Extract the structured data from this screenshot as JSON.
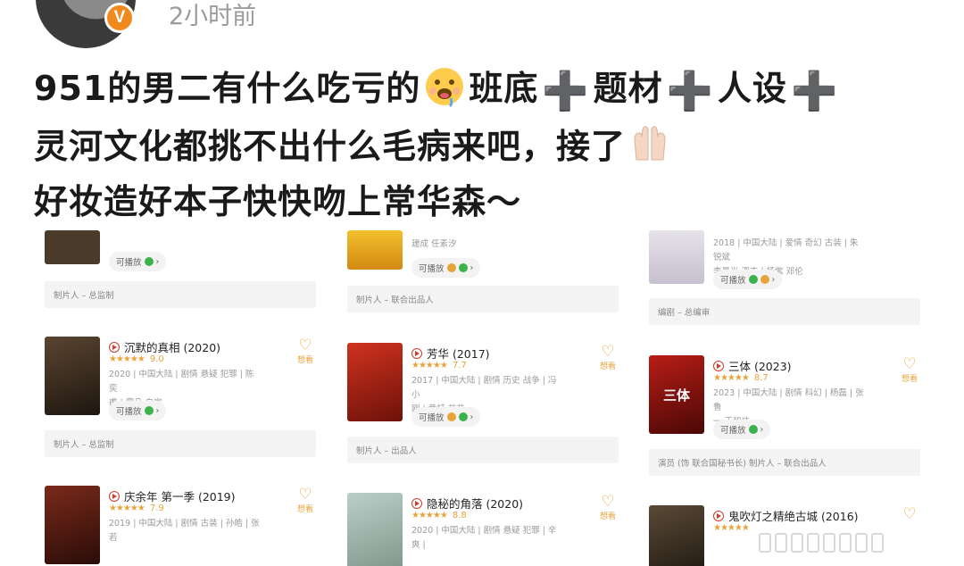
{
  "header": {
    "verified_badge": "V",
    "time_ago": "2小时前"
  },
  "post": {
    "line1": {
      "a": "951的男二有什么吃亏的",
      "b": "班底",
      "c": "题材",
      "d": "人设"
    },
    "line2": {
      "a": "灵河文化都挑不出什么毛病来吧，接了"
    },
    "line3": {
      "a": "好妆造好本子快快吻上常华森～"
    },
    "plus_symbol": "➕"
  },
  "common": {
    "playable": "可播放",
    "want": "想看",
    "heart": "♡",
    "chevron": "›",
    "stars": "★★★★★"
  },
  "columns": [
    {
      "top_fragment": {
        "role": "制片人 – 总监制"
      },
      "movies": [
        {
          "title": "沉默的真相 (2020)",
          "score": "9.0",
          "meta1": "2020 | 中国大陆 | 剧情 悬疑 犯罪 | 陈奕",
          "meta2": "甫 | 廖凡 白宇",
          "role": "制片人 – 总监制",
          "poster_color": "#3b2a1e"
        },
        {
          "title": "庆余年 第一季 (2019)",
          "score": "7.9",
          "meta1": "2019 | 中国大陆 | 剧情 古装 | 孙皓 | 张若",
          "meta2": "",
          "role": "",
          "poster_color": "#6a1c16"
        }
      ]
    },
    {
      "top_fragment": {
        "meta": "建成 任素汐",
        "role": "制片人 – 联合出品人"
      },
      "movies": [
        {
          "title": "芳华 (2017)",
          "score": "7.7",
          "meta1": "2017 | 中国大陆 | 剧情 历史 战争 | 冯小",
          "meta2": "刚 | 黄轩 苗苗",
          "role": "制片人 – 出品人",
          "poster_color": "#b22a1c"
        },
        {
          "title": "隐秘的角落 (2020)",
          "score": "8.8",
          "meta1": "2020 | 中国大陆 | 剧情 悬疑 犯罪 | 辛爽 |",
          "meta2": "",
          "role": "",
          "poster_color": "#9fb8b0"
        }
      ]
    },
    {
      "top_fragment": {
        "meta0": "2018 | 中国大陆 | 爱情 奇幻 古装 | 朱锐斌",
        "meta": "李曼光 滑丰 | 杨紫 邓伦",
        "role": "编剧 – 总编审"
      },
      "movies": [
        {
          "title": "三体 (2023)",
          "score": "8.7",
          "meta1": "2023 | 中国大陆 | 剧情 科幻 | 杨磊 | 张鲁",
          "meta2": "一 于和伟",
          "role": "演员 (饰 联合国秘书长)    制片人 – 联合出品人",
          "poster_color": "#8e1512",
          "poster_text": "三体"
        },
        {
          "title": "鬼吹灯之精绝古城 (2016)",
          "score": "",
          "meta1": "",
          "meta2": "",
          "role": "",
          "poster_color": "#2e2a24"
        }
      ]
    }
  ],
  "colors": {
    "accent": "#e8a33b",
    "play": "#d23b2a",
    "badge": "#f08a1e"
  }
}
